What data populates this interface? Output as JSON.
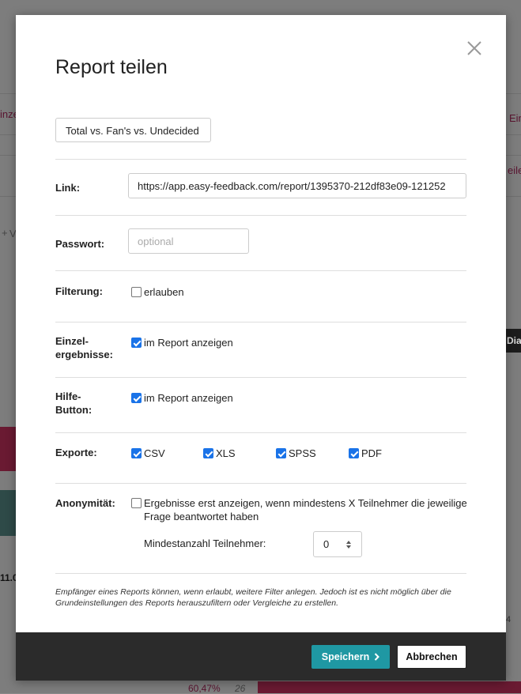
{
  "background": {
    "left_fragment_1": "inze",
    "right_fragment_1": "Ein",
    "right_fragment_2": "eiler",
    "left_fragment_2": "V",
    "right_fragment_3": "Diag",
    "left_fragment_3": "11.0",
    "bottom_percent": "60,47%",
    "bottom_count": "26",
    "right_fragment_4": "4"
  },
  "modal": {
    "title": "Report teilen",
    "preset": "Total vs. Fan's vs. Undecided",
    "link": {
      "label": "Link:",
      "value": "https://app.easy-feedback.com/report/1395370-212df83e09-121252"
    },
    "password": {
      "label": "Passwort:",
      "placeholder": "optional",
      "value": ""
    },
    "filtering": {
      "label": "Filterung:",
      "checkbox_label": "erlauben",
      "checked": false
    },
    "single_results": {
      "label_line1": "Einzel-",
      "label_line2": "ergebnisse:",
      "checkbox_label": "im Report anzeigen",
      "checked": true
    },
    "help_button": {
      "label_line1": "Hilfe-",
      "label_line2": "Button:",
      "checkbox_label": "im Report anzeigen",
      "checked": true
    },
    "exports": {
      "label": "Exporte:",
      "options": [
        {
          "label": "CSV",
          "checked": true
        },
        {
          "label": "XLS",
          "checked": true
        },
        {
          "label": "SPSS",
          "checked": true
        },
        {
          "label": "PDF",
          "checked": true
        }
      ]
    },
    "anonymity": {
      "label": "Anonymität:",
      "checkbox_label_line1": "Ergebnisse erst anzeigen, wenn mindestens X Teilnehmer die jeweilige",
      "checkbox_label_line2": "Frage beantwortet haben",
      "checked": false,
      "min_participants_label": "Mindestanzahl Teilnehmer:",
      "min_participants_value": "0"
    },
    "note": "Empfänger eines Reports können, wenn erlaubt, weitere Filter anlegen. Jedoch ist es nicht möglich über die Grundeinstellungen des Reports herauszufiltern oder Vergleiche zu erstellen.",
    "buttons": {
      "save": "Speichern",
      "cancel": "Abbrechen"
    }
  },
  "colors": {
    "primary": "#1f98a3",
    "checkbox": "#1a73e8",
    "footer": "#2b2b2b"
  }
}
